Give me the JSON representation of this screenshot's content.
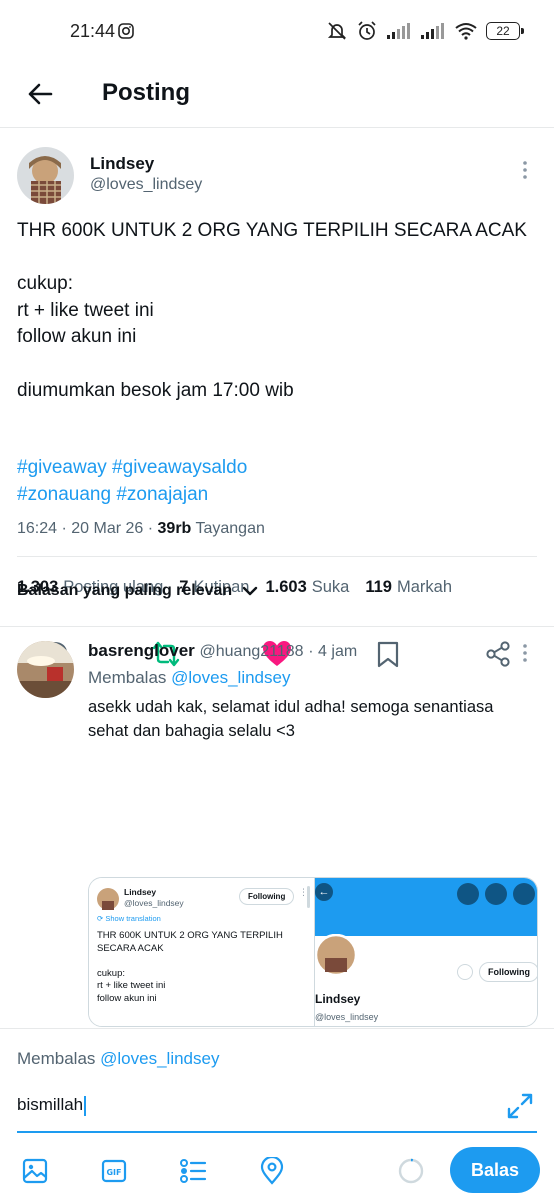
{
  "status_bar": {
    "time": "21:44",
    "battery": "22"
  },
  "header": {
    "title": "Posting"
  },
  "post": {
    "author_name": "Lindsey",
    "author_handle": "@loves_lindsey",
    "text": "THR 600K UNTUK 2 ORG YANG TERPILIH SECARA ACAK\n\ncukup:\nrt + like tweet ini\nfollow akun ini\n\ndiumumkan besok jam 17:00 wib",
    "hashtags_line1": "#giveaway #giveawaysaldo",
    "hashtags_line2": "#zonauang #zonajajan",
    "timestamp": "16:24 · 20 Mar 26 · ",
    "views_count": "39rb",
    "views_label": "Tayangan",
    "stats": [
      {
        "value": "1.303",
        "label": "Posting ulang"
      },
      {
        "value": "7",
        "label": "Kutipan"
      },
      {
        "value": "1.603",
        "label": "Suka"
      },
      {
        "value": "119",
        "label": "Markah"
      }
    ]
  },
  "sort": {
    "label": "Balasan yang paling relevan"
  },
  "reply": {
    "name": "basrenglover",
    "handle": "@huang21188",
    "time": "· 4 jam",
    "replying_prefix": "Membalas ",
    "replying_handle": "@loves_lindsey",
    "text": "asekk udah kak, selamat idul adha! semoga senantiasa sehat dan bahagia selalu <3",
    "embed_left": {
      "name": "Lindsey",
      "handle": "@loves_lindsey",
      "follow": "Following",
      "show_translation": "Show translation",
      "text": "THR 600K UNTUK 2 ORG YANG TERPILIH SECARA ACAK\n\ncukup:\nrt + like tweet ini\nfollow akun ini"
    },
    "embed_right": {
      "follow": "Following",
      "name": "Lindsey",
      "handle": "@loves_lindsey"
    }
  },
  "composer": {
    "replying_prefix": "Membalas ",
    "replying_handle": "@loves_lindsey",
    "input_value": "bismillah",
    "send_label": "Balas"
  },
  "colors": {
    "accent": "#1d9bf0",
    "like": "#f91880",
    "retweet": "#00ba7c",
    "secondary_text": "#536471"
  }
}
